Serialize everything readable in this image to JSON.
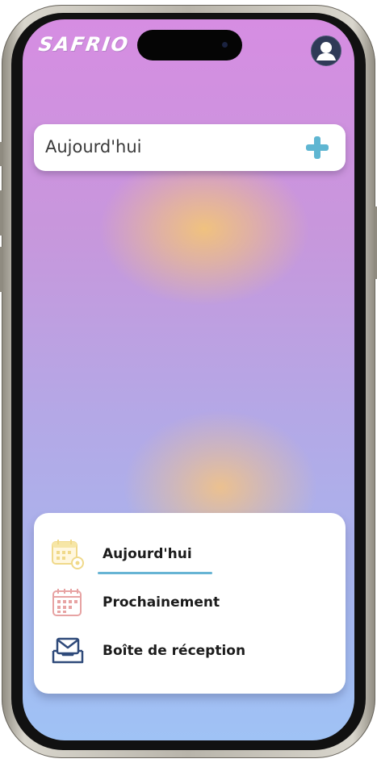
{
  "app": {
    "logo_text": "SAFRIO"
  },
  "header": {
    "today_title": "Aujourd'hui"
  },
  "nav": {
    "items": [
      {
        "label": "Aujourd'hui",
        "icon": "calendar-settings-icon",
        "active": true
      },
      {
        "label": "Prochainement",
        "icon": "calendar-grid-icon",
        "active": false
      },
      {
        "label": "Boîte de réception",
        "icon": "inbox-icon",
        "active": false
      }
    ]
  },
  "colors": {
    "accent": "#67b4d4",
    "plus": "#5fb6d2",
    "gradient_top": "#d68de2",
    "gradient_bottom": "#9fc2f5",
    "blob": "#f2c47a"
  }
}
